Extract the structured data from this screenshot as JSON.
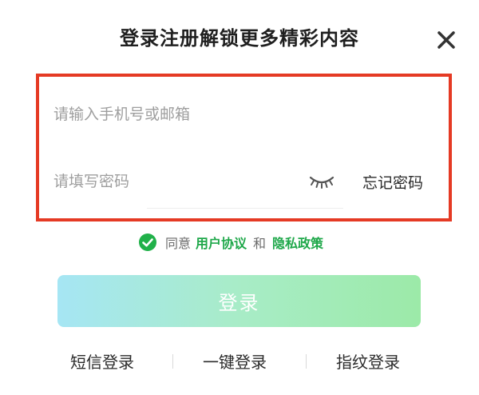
{
  "title": "登录注册解锁更多精彩内容",
  "form": {
    "phone_placeholder": "请输入手机号或邮箱",
    "password_placeholder": "请填写密码",
    "forgot_label": "忘记密码"
  },
  "agreement": {
    "checked": true,
    "prefix": "同意",
    "user_agreement": "用户协议",
    "and": "和",
    "privacy_policy": "隐私政策"
  },
  "login_button": "登录",
  "alt_login": {
    "sms": "短信登录",
    "one_click": "一键登录",
    "fingerprint": "指纹登录"
  },
  "icons": {
    "close": "close-icon",
    "password_visibility": "eye-closed-icon",
    "agree_check": "check-circle-icon"
  },
  "colors": {
    "highlight_border": "#e53a24",
    "link_green": "#1fa84a",
    "check_green": "#21b14a",
    "button_gradient_start": "#a6e6f4",
    "button_gradient_end": "#9ceaa8"
  }
}
